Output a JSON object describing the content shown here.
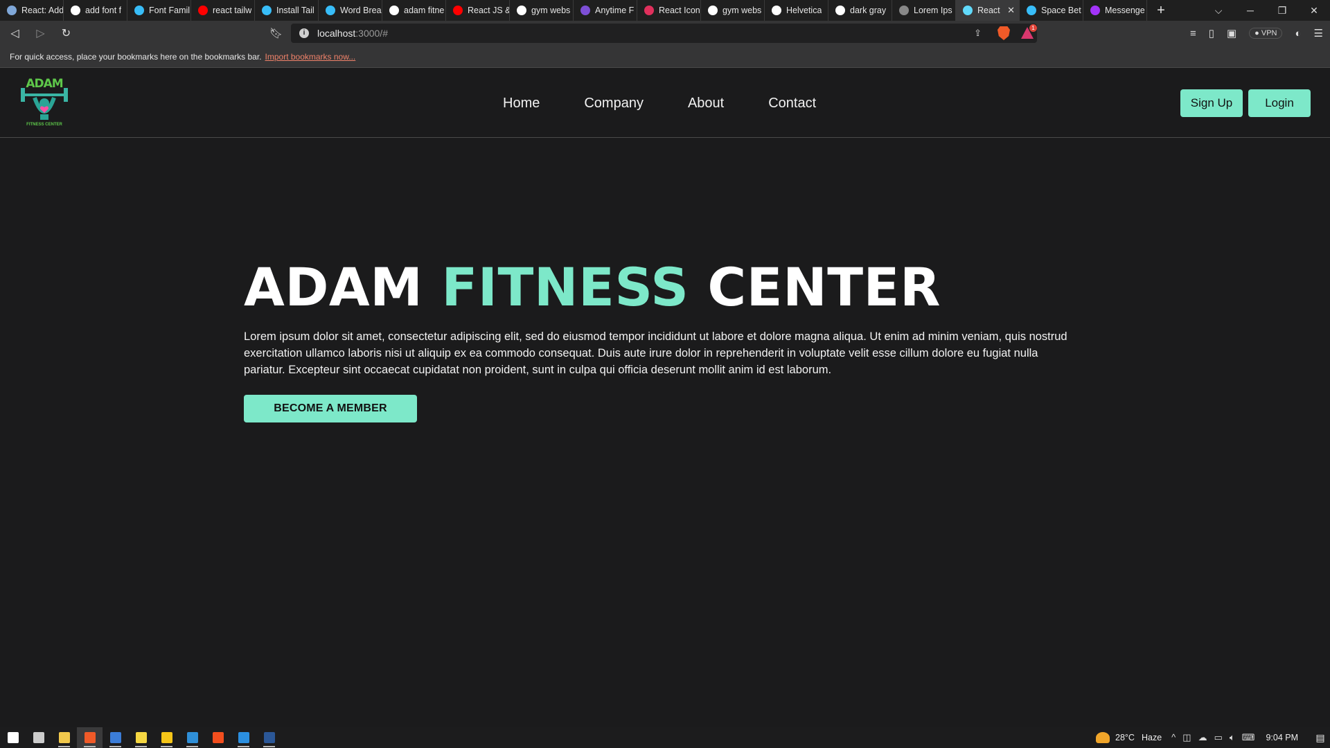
{
  "browser": {
    "tabs": [
      {
        "label": "React: Add",
        "favicon_color": "#7fa7d8",
        "icon": "react-tab-icon"
      },
      {
        "label": "add font f",
        "favicon_color": "#ffffff",
        "icon": "google-icon"
      },
      {
        "label": "Font Famil",
        "favicon_color": "#38bdf8",
        "icon": "tailwind-icon"
      },
      {
        "label": "react tailw",
        "favicon_color": "#ff0000",
        "icon": "youtube-icon"
      },
      {
        "label": "Install Tail",
        "favicon_color": "#38bdf8",
        "icon": "tailwind-icon"
      },
      {
        "label": "Word Brea",
        "favicon_color": "#38bdf8",
        "icon": "tailwind-icon"
      },
      {
        "label": "adam fitne",
        "favicon_color": "#ffffff",
        "icon": "google-icon"
      },
      {
        "label": "React JS &",
        "favicon_color": "#ff0000",
        "icon": "youtube-icon"
      },
      {
        "label": "gym webs",
        "favicon_color": "#ffffff",
        "icon": "google-icon"
      },
      {
        "label": "Anytime F",
        "favicon_color": "#7d4fd6",
        "icon": "anytime-fitness-icon"
      },
      {
        "label": "React Icon",
        "favicon_color": "#e0305c",
        "icon": "react-icons-icon"
      },
      {
        "label": "gym webs",
        "favicon_color": "#ffffff",
        "icon": "google-icon"
      },
      {
        "label": "Helvetica",
        "favicon_color": "#ffffff",
        "icon": "google-icon"
      },
      {
        "label": "dark gray",
        "favicon_color": "#ffffff",
        "icon": "google-icon"
      },
      {
        "label": "Lorem Ips",
        "favicon_color": "#888888",
        "icon": "lorem-icon"
      },
      {
        "label": "React",
        "favicon_color": "#61dafb",
        "icon": "react-icon",
        "active": true
      },
      {
        "label": "Space Bet",
        "favicon_color": "#38bdf8",
        "icon": "tailwind-icon"
      },
      {
        "label": "Messenge",
        "favicon_color": "#a334fa",
        "icon": "messenger-icon"
      }
    ],
    "new_tab": "+",
    "tab_close": "✕",
    "window_controls": {
      "tab_search": "⌵",
      "minimize": "─",
      "restore": "❐",
      "close": "✕"
    },
    "url_host": "localhost",
    "url_rest": ":3000/#",
    "vpn_label": "VPN",
    "rewards_badge": "1",
    "bookmarks_prompt": "For quick access, place your bookmarks here on the bookmarks bar.",
    "bookmarks_link": "Import bookmarks now..."
  },
  "site": {
    "logo_text": "ADAM",
    "logo_subtext": "FITNESS CENTER",
    "nav": [
      "Home",
      "Company",
      "About",
      "Contact"
    ],
    "signup_label": "Sign Up",
    "login_label": "Login",
    "accent_color": "#7de8c9",
    "background_color": "#1b1b1c"
  },
  "hero": {
    "title_part1": "ADAM ",
    "title_accent": "FITNESS",
    "title_part2": " CENTER",
    "body": "Lorem ipsum dolor sit amet, consectetur adipiscing elit, sed do eiusmod tempor incididunt ut labore et dolore magna aliqua. Ut enim ad minim veniam, quis nostrud exercitation ullamco laboris nisi ut aliquip ex ea commodo consequat. Duis aute irure dolor in reprehenderit in voluptate velit esse cillum dolore eu fugiat nulla pariatur. Excepteur sint occaecat cupidatat non proident, sunt in culpa qui officia deserunt mollit anim id est laborum.",
    "cta_label": "BECOME A MEMBER"
  },
  "taskbar": {
    "apps": [
      {
        "name": "windows-start-icon",
        "color": "#ffffff"
      },
      {
        "name": "task-view-icon",
        "color": "#cccccc"
      },
      {
        "name": "file-explorer-icon",
        "color": "#f2c94c",
        "running": true
      },
      {
        "name": "brave-browser-icon",
        "color": "#f05a28",
        "running": true,
        "active": true
      },
      {
        "name": "layers-app-icon",
        "color": "#3b7dd8",
        "running": true
      },
      {
        "name": "sticky-notes-icon",
        "color": "#f5d742",
        "running": true
      },
      {
        "name": "yellow-app-icon",
        "color": "#f5c518",
        "running": true
      },
      {
        "name": "photos-app-icon",
        "color": "#2f8fd8",
        "running": true
      },
      {
        "name": "figma-icon",
        "color": "#f24e1e"
      },
      {
        "name": "vscode-icon",
        "color": "#2b8fe0",
        "running": true
      },
      {
        "name": "word-icon",
        "color": "#2b5797",
        "running": true
      }
    ],
    "temperature": "28°C",
    "weather": "Haze",
    "time": "9:04 PM"
  }
}
